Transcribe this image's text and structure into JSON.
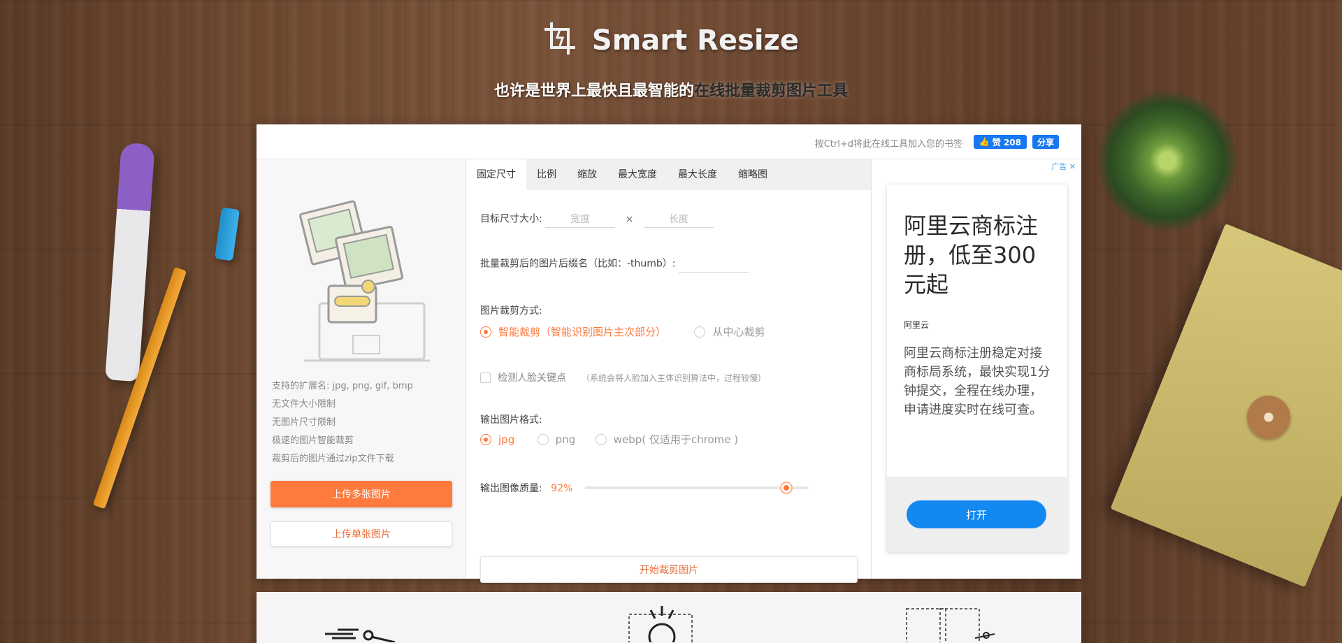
{
  "header": {
    "brand": "Smart Resize",
    "tagline_prefix": "也许是世界上最快且最智能的",
    "tagline_highlight": "在线批量裁剪图片工具"
  },
  "topbar": {
    "bookmark_hint": "按Ctrl+d将此在线工具加入您的书签",
    "fb_like_label": "赞 208",
    "fb_share_label": "分享"
  },
  "sidebar": {
    "features": [
      "支持的扩展名: jpg, png, gif, bmp",
      "无文件大小限制",
      "无图片尺寸限制",
      "极速的图片智能裁剪",
      "裁剪后的图片通过zip文件下载"
    ],
    "upload_multi": "上传多张图片",
    "upload_single": "上传单张图片"
  },
  "tabs": [
    "固定尺寸",
    "比例",
    "缩放",
    "最大宽度",
    "最大长度",
    "缩略图"
  ],
  "form": {
    "target_size_label": "目标尺寸大小:",
    "width_placeholder": "宽度",
    "times": "×",
    "height_placeholder": "长度",
    "suffix_label": "批量裁剪后的图片后缀名（比如：-thumb）:",
    "crop_mode_label": "图片裁剪方式:",
    "crop_smart": "智能裁剪（智能识别图片主次部分）",
    "crop_center": "从中心裁剪",
    "face_detect_label": "检测人脸关键点",
    "face_detect_note": "（系统会将人脸加入主体识别算法中，过程较慢）",
    "format_label": "输出图片格式:",
    "format_jpg": "jpg",
    "format_png": "png",
    "format_webp": "webp( 仅适用于chrome )",
    "quality_label": "输出图像质量:",
    "quality_value": "92%",
    "quality_fraction": 0.9,
    "start_button": "开始裁剪图片"
  },
  "ad": {
    "tag": "广告",
    "title": "阿里云商标注册，低至300元起",
    "brand": "阿里云",
    "description": "阿里云商标注册稳定对接商标局系统，最快实现1分钟提交，全程在线办理，申请进度实时在线可查。",
    "open_button": "打开"
  },
  "colors": {
    "accent": "#ff7a3d",
    "facebook": "#1877f2",
    "ad_button": "#1288f0"
  }
}
